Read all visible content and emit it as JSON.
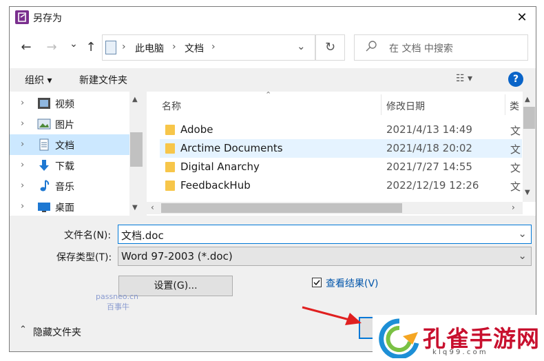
{
  "window": {
    "title": "另存为",
    "close_glyph": "✕"
  },
  "nav": {
    "back_glyph": "←",
    "forward_glyph": "→",
    "recent_glyph": "⌄",
    "up_glyph": "↑",
    "breadcrumb": [
      "此电脑",
      "文档"
    ],
    "separator": "›",
    "dropdown_glyph": "⌄",
    "refresh_glyph": "↻",
    "search_placeholder": "在 文档 中搜索"
  },
  "toolbar": {
    "organize_label": "组织 ▾",
    "new_folder_label": "新建文件夹",
    "view_glyph": "☷ ▾",
    "help_glyph": "?"
  },
  "sidebar": {
    "items": [
      {
        "label": "视频",
        "icon": "video-icon",
        "selected": false
      },
      {
        "label": "图片",
        "icon": "picture-icon",
        "selected": false
      },
      {
        "label": "文档",
        "icon": "document-icon",
        "selected": true
      },
      {
        "label": "下载",
        "icon": "download-icon",
        "selected": false
      },
      {
        "label": "音乐",
        "icon": "music-icon",
        "selected": false
      },
      {
        "label": "桌面",
        "icon": "desktop-icon",
        "selected": false
      }
    ]
  },
  "files": {
    "columns": {
      "name": "名称",
      "date": "修改日期",
      "type": "类"
    },
    "rows": [
      {
        "name": "Adobe",
        "date": "2021/4/13 14:49",
        "type": "文"
      },
      {
        "name": "Arctime Documents",
        "date": "2021/4/18 20:02",
        "type": "文"
      },
      {
        "name": "Digital Anarchy",
        "date": "2021/7/27 14:55",
        "type": "文"
      },
      {
        "name": "FeedbackHub",
        "date": "2022/12/19 12:26",
        "type": "文"
      }
    ]
  },
  "form": {
    "filename_label": "文件名(N):",
    "filename_value": "文档.doc",
    "filetype_label": "保存类型(T):",
    "filetype_value": "Word 97-2003 (*.doc)",
    "settings_button": "设置(G)...",
    "view_results_label": "查看结果(V)",
    "view_results_checked": true,
    "hide_folders_label": "隐藏文件夹"
  },
  "watermarks": {
    "passneo_line1": "passneo.cn",
    "passneo_line2": "百事牛",
    "brand_name": "孔雀手游网",
    "brand_url": "k l q 9 9 . c o m"
  },
  "colors": {
    "accent": "#0078d7",
    "selection": "#cce8ff",
    "brand_red": "#c8102e"
  }
}
